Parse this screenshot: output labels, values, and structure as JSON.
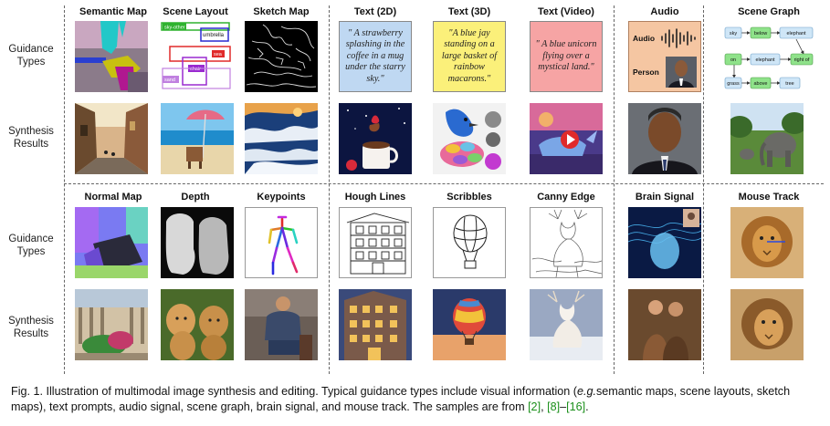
{
  "row_labels": {
    "guidance_types": [
      "Guidance",
      "Types"
    ],
    "synthesis_results": [
      "Synthesis",
      "Results"
    ]
  },
  "top_headers": [
    "Semantic Map",
    "Scene Layout",
    "Sketch Map",
    "Text (2D)",
    "Text (3D)",
    "Text (Video)",
    "Audio",
    "Scene Graph"
  ],
  "bottom_headers": [
    "Normal Map",
    "Depth",
    "Keypoints",
    "Hough Lines",
    "Scribbles",
    "Canny Edge",
    "Brain Signal",
    "Mouse Track"
  ],
  "scene_layout_labels": [
    "sky-other",
    "umbrella",
    "sea",
    "chair",
    "sand"
  ],
  "text_prompts": {
    "text_2d": "\" A strawberry splashing in the coffee in a mug under the starry sky.\"",
    "text_3d": "\"A blue jay standing on a large basket of rainbow macarons.\"",
    "text_video": "\" A blue unicorn flying over a mystical land.\""
  },
  "audio_labels": {
    "audio": "Audio",
    "person": "Person"
  },
  "scene_graph_nodes": [
    "sky",
    "below",
    "elephant",
    "on",
    "elephant",
    "right of",
    "grass",
    "above",
    "tree"
  ],
  "caption": {
    "prefix": "Fig. 1.  Illustration of multimodal image synthesis and editing. Typical guidance types include visual information (",
    "eg": "e.g.",
    "middle": "semantic maps, scene layouts, sketch maps), text prompts, audio signal, scene graph, brain signal, and mouse track. The samples are from ",
    "ref1": "[2]",
    "sep1": ", ",
    "ref2": "[8]",
    "dash": "–",
    "ref3": "[16]",
    "suffix": "."
  },
  "colors": {
    "text2d_bg": "#bfd8f2",
    "text3d_bg": "#fbf07a",
    "textvideo_bg": "#f6a4a4",
    "audio_bg": "#f5c6a2",
    "sg_node_blue": "#cfe6f7",
    "sg_node_green": "#8fe28a",
    "citation": "#1a8f1a"
  }
}
